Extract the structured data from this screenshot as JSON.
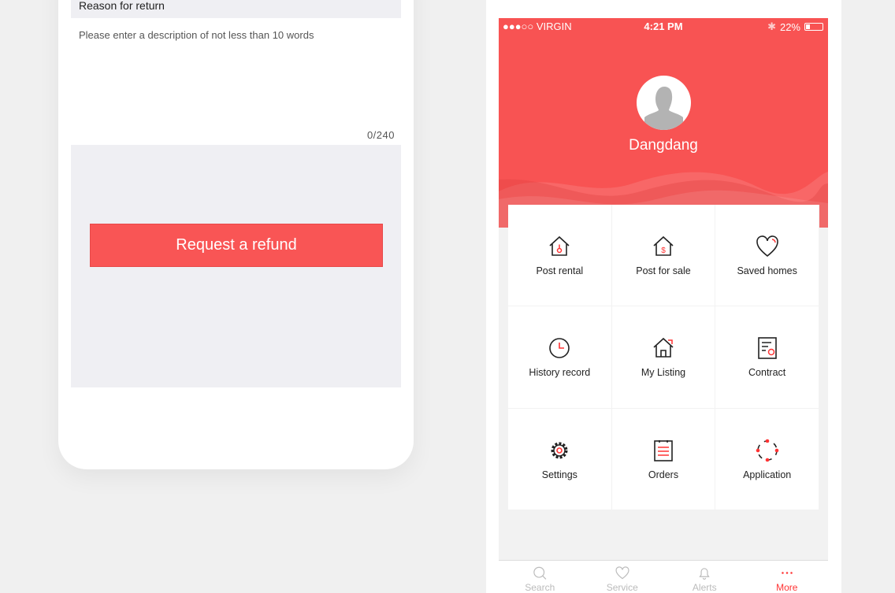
{
  "refund_form": {
    "reason_label": "Reason for return",
    "description_placeholder": "Please enter a description of not less than 10 words",
    "char_counter": "0/240",
    "submit_label": "Request a refund"
  },
  "status_bar": {
    "carrier": "●●●○○ VIRGIN",
    "time": "4:21 PM",
    "battery": "22%",
    "battery_level": 0.22
  },
  "profile": {
    "username": "Dangdang"
  },
  "accent_color": "#f85353",
  "menu": [
    {
      "label": "Post rental",
      "icon": "house-key-icon"
    },
    {
      "label": "Post for sale",
      "icon": "house-dollar-icon"
    },
    {
      "label": "Saved homes",
      "icon": "heart-icon"
    },
    {
      "label": "History record",
      "icon": "clock-icon"
    },
    {
      "label": "My Listing",
      "icon": "house-arrow-icon"
    },
    {
      "label": "Contract",
      "icon": "contract-icon"
    },
    {
      "label": "Settings",
      "icon": "gear-icon"
    },
    {
      "label": "Orders",
      "icon": "clipboard-list-icon"
    },
    {
      "label": "Application",
      "icon": "circle-dots-icon"
    }
  ],
  "tabs": [
    {
      "label": "Search",
      "icon": "search-icon"
    },
    {
      "label": "Service",
      "icon": "heart-icon"
    },
    {
      "label": "Alerts",
      "icon": "bell-icon"
    },
    {
      "label": "More",
      "icon": "more-dots-icon",
      "active": true
    }
  ]
}
